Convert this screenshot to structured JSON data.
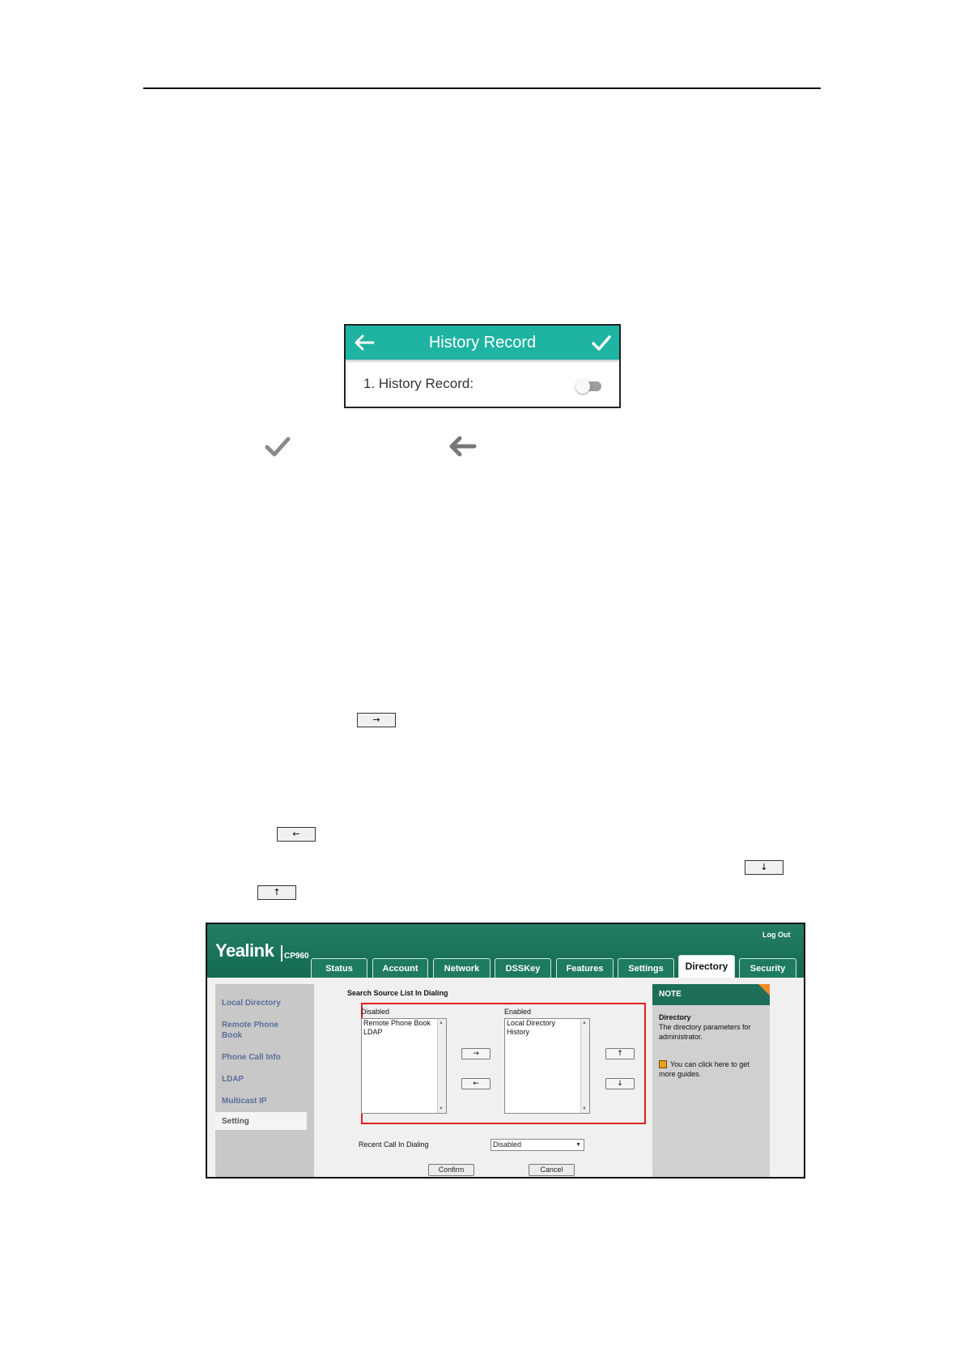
{
  "phone_screen": {
    "title": "History Record",
    "field_label": "1. History Record:",
    "toggle_on": false
  },
  "inline_buttons": {
    "move_right": "→",
    "move_left": "←",
    "move_down": "↓",
    "move_up": "↑"
  },
  "web_ui": {
    "logo": "Yealink",
    "model": "CP960",
    "logout": "Log Out",
    "tabs": [
      "Status",
      "Account",
      "Network",
      "DSSKey",
      "Features",
      "Settings",
      "Directory",
      "Security"
    ],
    "active_tab": "Directory",
    "sidebar": [
      "Local Directory",
      "Remote Phone Book",
      "Phone Call Info",
      "LDAP",
      "Multicast IP",
      "Setting"
    ],
    "active_sidebar": "Setting",
    "section_title": "Search Source List In Dialing",
    "disabled_label": "Disabled",
    "enabled_label": "Enabled",
    "disabled_items": [
      "Remote Phone Book",
      "LDAP"
    ],
    "enabled_items": [
      "Local Directory",
      "History"
    ],
    "btn_right": "→",
    "btn_left": "←",
    "btn_up": "↑",
    "btn_down": "↓",
    "recent_call_label": "Recent Call In Dialing",
    "recent_call_value": "Disabled",
    "confirm": "Confirm",
    "cancel": "Cancel",
    "note": {
      "head": "NOTE",
      "title": "Directory",
      "body": "The directory parameters for administrator.",
      "guide": "You can click here to get more guides."
    }
  },
  "colors": {
    "phone_teal": "#1fb3a2",
    "yealink_green": "#1c7d63",
    "highlight_red": "#e02020"
  }
}
